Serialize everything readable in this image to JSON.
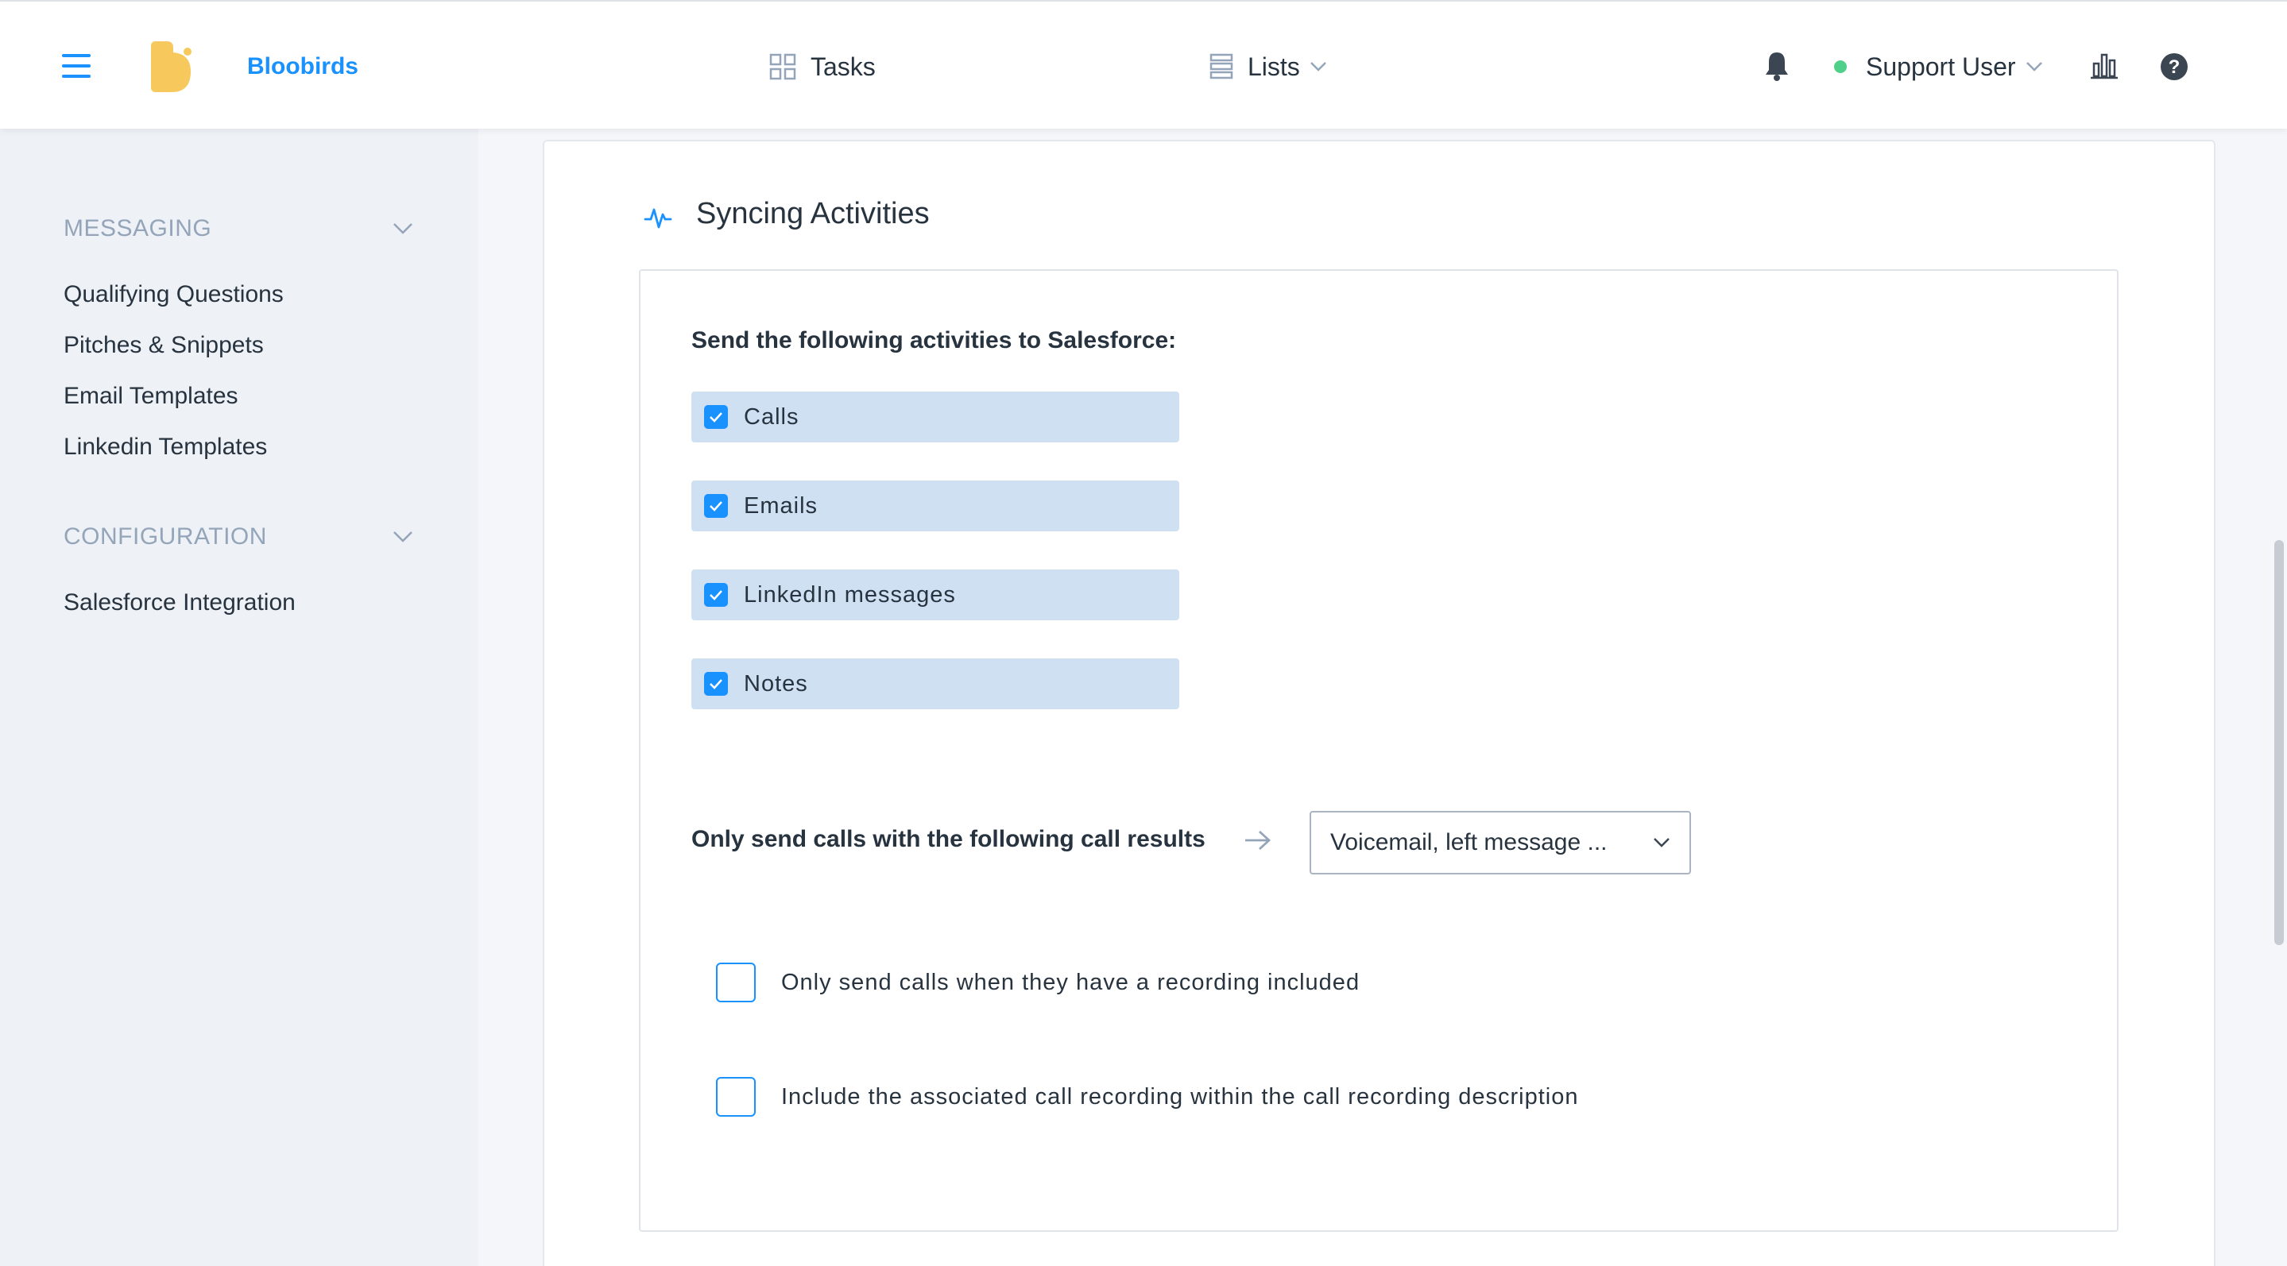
{
  "header": {
    "brand": "Bloobirds",
    "nav": {
      "tasks": "Tasks",
      "lists": "Lists"
    },
    "user": {
      "name": "Support User",
      "status_color": "#4ed08a"
    },
    "icons": [
      "menu-icon",
      "logo-icon",
      "grid-icon",
      "list-icon",
      "bell-icon",
      "bar-chart-icon",
      "help-icon"
    ]
  },
  "sidebar": {
    "sections": [
      {
        "title": "MESSAGING",
        "items": [
          "Qualifying Questions",
          "Pitches & Snippets",
          "Email Templates",
          "Linkedin Templates"
        ]
      },
      {
        "title": "CONFIGURATION",
        "items": [
          "Salesforce Integration"
        ]
      }
    ]
  },
  "main": {
    "title": "Syncing Activities",
    "send_label": "Send the following activities to Salesforce:",
    "activities": [
      {
        "label": "Calls",
        "checked": true
      },
      {
        "label": "Emails",
        "checked": true
      },
      {
        "label": "LinkedIn messages",
        "checked": true
      },
      {
        "label": "Notes",
        "checked": true
      }
    ],
    "call_results_label": "Only send calls with the following call results",
    "call_results_value": "Voicemail, left message ...",
    "options": [
      {
        "label": "Only send calls when they have a recording included",
        "checked": false
      },
      {
        "label": "Include the associated call recording within the call recording description",
        "checked": false
      }
    ]
  },
  "colors": {
    "accent": "#1991ff",
    "pill_bg": "#d0e0f3",
    "sidebar_bg": "#eef1f6",
    "section_title": "#94a5ba",
    "logo": "#f7c95c"
  }
}
